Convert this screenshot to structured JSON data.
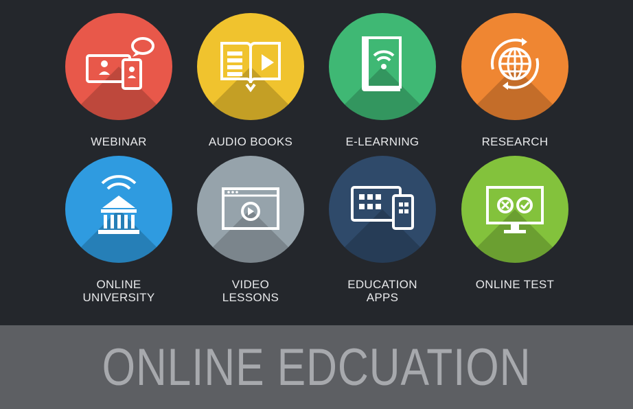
{
  "tiles": [
    {
      "label": "WEBINAR",
      "color": "#e8584a",
      "icon": "webinar-icon"
    },
    {
      "label": "AUDIO BOOKS",
      "color": "#f0c32e",
      "icon": "audio-book-icon"
    },
    {
      "label": "E-LEARNING",
      "color": "#3fb874",
      "icon": "e-learning-icon"
    },
    {
      "label": "RESEARCH",
      "color": "#ef8632",
      "icon": "globe-refresh-icon"
    },
    {
      "label": "ONLINE\nUNIVERSITY",
      "color": "#2f9be0",
      "icon": "university-icon"
    },
    {
      "label": "VIDEO\nLESSONS",
      "color": "#96a3ab",
      "icon": "video-player-icon"
    },
    {
      "label": "EDUCATION\nAPPS",
      "color": "#2f4a6a",
      "icon": "apps-devices-icon"
    },
    {
      "label": "ONLINE TEST",
      "color": "#83c23c",
      "icon": "test-monitor-icon"
    }
  ],
  "banner": {
    "title": "ONLINE EDCUATION"
  }
}
